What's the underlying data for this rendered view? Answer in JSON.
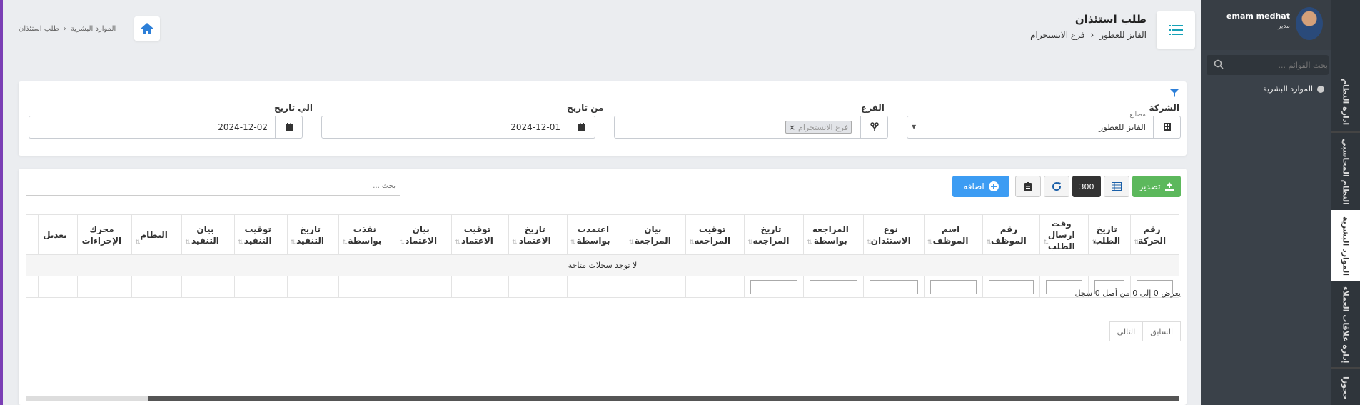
{
  "header": {
    "page_title": "طلب استئذان",
    "company": "الفايز للعطور",
    "branch": "فرع الانستجرام",
    "breadcrumb": [
      "الموارد البشرية",
      "طلب استئذان"
    ]
  },
  "filters": {
    "company_label": "الشركة",
    "company_sub_label": "مصانع",
    "company_value": "الفايز للعطور",
    "branch_label": "الفرع",
    "branch_tag": "فرع الانستجرام",
    "from_label": "من تاريخ",
    "from_value": "2024-12-01",
    "to_label": "الي تاريخ",
    "to_value": "2024-12-02"
  },
  "toolbar": {
    "export_label": "تصدير",
    "page_size": "300",
    "add_label": "اضافه",
    "search_placeholder": "بحث ..."
  },
  "table": {
    "columns": [
      [
        "رقم",
        "الحركة"
      ],
      [
        "تاريخ",
        "الطلب"
      ],
      [
        "وقت",
        "ارسال",
        "الطلب"
      ],
      [
        "رقم",
        "الموظف"
      ],
      [
        "اسم",
        "الموظف"
      ],
      [
        "نوع",
        "الاستئذان"
      ],
      [
        "المراجعه",
        "بواسطة"
      ],
      [
        "تاريخ",
        "المراجعه"
      ],
      [
        "توقيت",
        "المراجعه"
      ],
      [
        "بيان",
        "المراجعة"
      ],
      [
        "اعتمدت",
        "بواسطة"
      ],
      [
        "تاريخ",
        "الاعتماد"
      ],
      [
        "توقيت",
        "الاعتماد"
      ],
      [
        "بيان",
        "الاعتماد"
      ],
      [
        "نفذت",
        "بواسطة"
      ],
      [
        "تاريخ",
        "التنفيذ"
      ],
      [
        "توقيت",
        "التنفيذ"
      ],
      [
        "بيان",
        "التنفيذ"
      ],
      [
        "النظام"
      ],
      [
        "محرك",
        "الإجراءات"
      ],
      [
        "تعديل"
      ]
    ],
    "empty_message": "لا توجد سجلات متاحة",
    "info": "يعرض 0 إلى 0 من أصل 0 سجل",
    "prev": "السابق",
    "next": "التالي"
  },
  "sidebar": {
    "user_name": "emam medhat",
    "user_role": "مدير",
    "search_placeholder": "بحث القوائم ...",
    "active_item": "الموارد البشرية",
    "vtabs": [
      "ادارة النظام",
      "النظام المحاسبي",
      "الموارد البشرية",
      "إدارة علاقات العملاء",
      "حجوزا"
    ]
  },
  "colors": {
    "accent_teal": "#17a2b8",
    "export_green": "#5cb85c",
    "add_blue": "#3c9cf3",
    "sidebar_dark": "#3a4149",
    "left_strip": "#7b3fb5"
  }
}
